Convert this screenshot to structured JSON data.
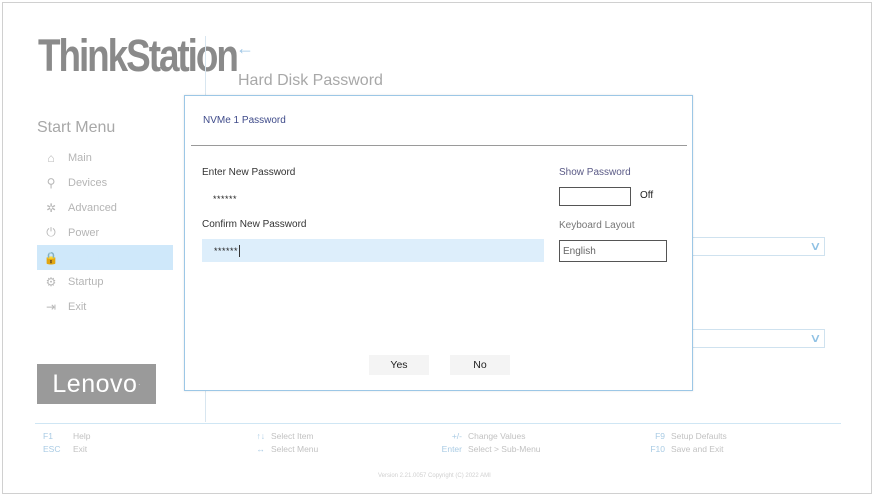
{
  "brand": "ThinkStation",
  "page": {
    "back_glyph": "←",
    "title": "Hard Disk Password"
  },
  "sidebar": {
    "title": "Start Menu",
    "items": [
      {
        "label": "Main",
        "icon": "home-icon",
        "glyph": "⌂"
      },
      {
        "label": "Devices",
        "icon": "devices-icon",
        "glyph": "⚲"
      },
      {
        "label": "Advanced",
        "icon": "advanced-icon",
        "glyph": "✲"
      },
      {
        "label": "Power",
        "icon": "power-icon",
        "glyph": "⏻"
      },
      {
        "label": "Security",
        "icon": "lock-icon",
        "glyph": "🔒",
        "active": true
      },
      {
        "label": "Startup",
        "icon": "startup-icon",
        "glyph": "⚙"
      },
      {
        "label": "Exit",
        "icon": "exit-icon",
        "glyph": "⇥"
      }
    ]
  },
  "logo": {
    "text": "Lenovo",
    "mark": "."
  },
  "dialog": {
    "title": "NVMe 1 Password",
    "new_password_label": "Enter New Password",
    "new_password_value": "******",
    "confirm_password_label": "Confirm New Password",
    "confirm_password_value": "******",
    "show_password_label": "Show Password",
    "show_password_state": "Off",
    "keyboard_layout_label": "Keyboard Layout",
    "keyboard_layout_value": "English",
    "yes_label": "Yes",
    "no_label": "No"
  },
  "background_selects": {
    "chevron": "∨"
  },
  "footer": {
    "keys": [
      {
        "key": "F1",
        "label": "Help"
      },
      {
        "key": "ESC",
        "label": "Exit"
      },
      {
        "key": "↑↓",
        "label": "Select Item"
      },
      {
        "key": "↔",
        "label": "Select Menu"
      },
      {
        "key": "+/-",
        "label": "Change Values"
      },
      {
        "key": "Enter",
        "label": "Select > Sub-Menu"
      },
      {
        "key": "F9",
        "label": "Setup Defaults"
      },
      {
        "key": "F10",
        "label": "Save and Exit"
      }
    ],
    "version": "Version 2.21.0057 Copyright (C) 2022 AMI"
  },
  "colors": {
    "accent": "#9cc7e6",
    "active_bg": "#cfe8fa",
    "field_bg": "#ddeefb",
    "title_text": "#3f4b8a"
  }
}
